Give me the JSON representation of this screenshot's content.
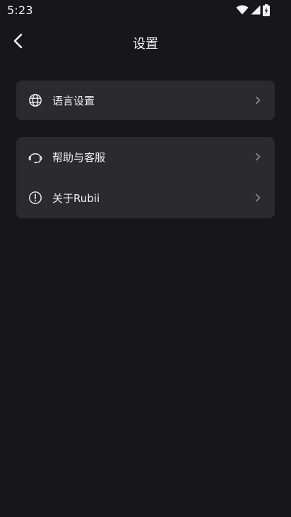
{
  "status_bar": {
    "time": "5:23",
    "icons": [
      "wifi-icon",
      "cellular-signal-icon",
      "battery-charging-icon"
    ]
  },
  "header": {
    "title": "设置",
    "back_icon": "chevron-left-icon"
  },
  "settings": {
    "groups": [
      {
        "items": [
          {
            "label": "语言设置",
            "icon": "globe-icon"
          }
        ]
      },
      {
        "items": [
          {
            "label": "帮助与客服",
            "icon": "headset-icon"
          },
          {
            "label": "关于Rubii",
            "icon": "info-circle-icon"
          }
        ]
      }
    ]
  },
  "colors": {
    "background": "#17171a",
    "card": "#2a2a2f",
    "text": "#f2f2f4",
    "chevron": "#8a8a90"
  }
}
